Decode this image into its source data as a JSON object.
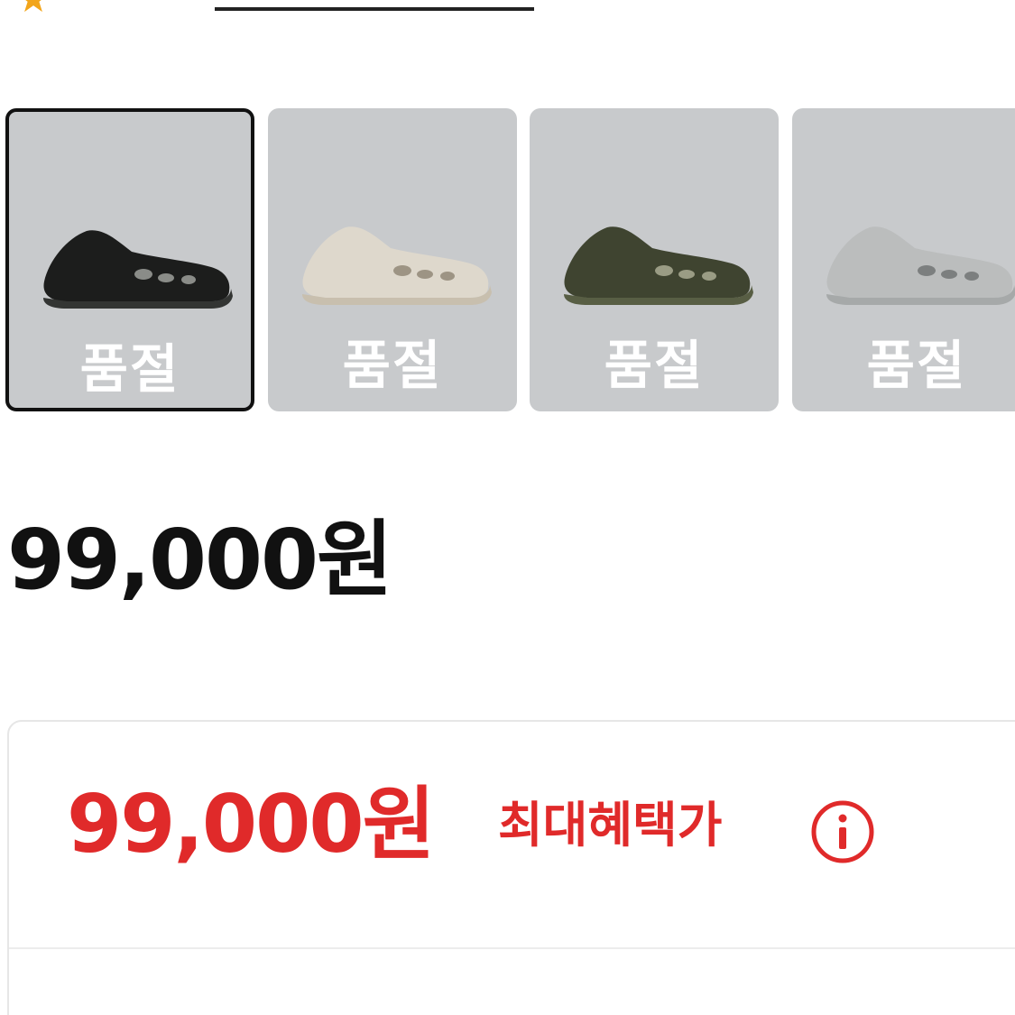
{
  "swatches": [
    {
      "label": "품절",
      "selected": true,
      "color": "#1c1d1c",
      "accent": "#333533"
    },
    {
      "label": "품절",
      "selected": false,
      "color": "#ded8cc",
      "accent": "#c8bfae"
    },
    {
      "label": "품절",
      "selected": false,
      "color": "#3f4430",
      "accent": "#585e44"
    },
    {
      "label": "품절",
      "selected": false,
      "color": "#bbbdbd",
      "accent": "#a6a9a9"
    }
  ],
  "price": {
    "amount": "99,000원"
  },
  "benefit": {
    "amount": "99,000원",
    "label": "최대혜택가"
  },
  "colors": {
    "accent_red": "#e02a2a",
    "star": "#f2a51a",
    "swatch_bg": "#c8cacc"
  }
}
